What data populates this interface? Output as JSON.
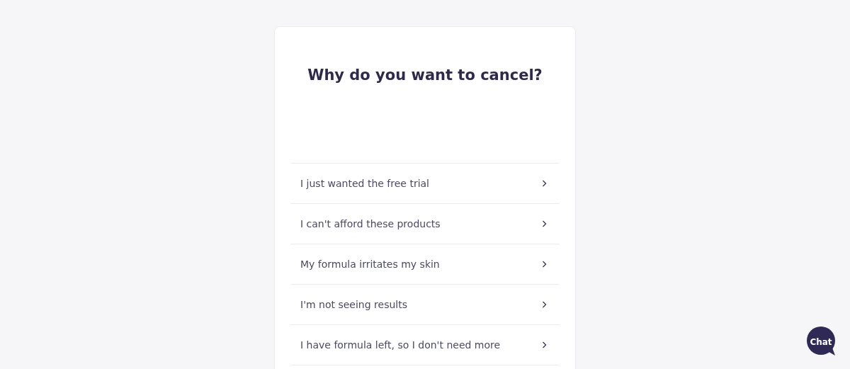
{
  "title": "Why do you want to cancel?",
  "reasons": [
    {
      "label": "I just wanted the free trial"
    },
    {
      "label": "I can't afford these products"
    },
    {
      "label": "My formula irritates my skin"
    },
    {
      "label": "I'm not seeing results"
    },
    {
      "label": "I have formula left, so I don't need more"
    }
  ],
  "chat_button": {
    "label": "Chat"
  }
}
